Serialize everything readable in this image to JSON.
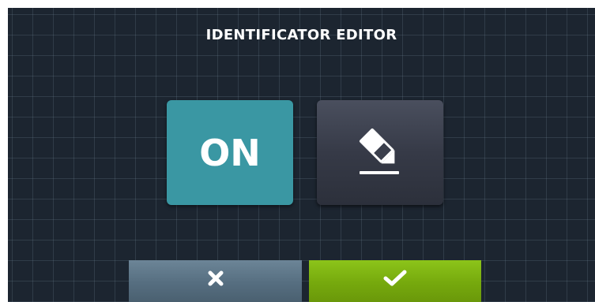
{
  "screen": {
    "title": "IDENTIFICATOR EDITOR"
  },
  "toggle": {
    "label": "ON",
    "color": "#3a97a3"
  },
  "edit": {
    "icon": "pencil-icon"
  },
  "actions": {
    "cancel_icon": "close-icon",
    "confirm_icon": "checkmark-icon",
    "cancel_color": "#5f7889",
    "confirm_color": "#7fb515"
  }
}
